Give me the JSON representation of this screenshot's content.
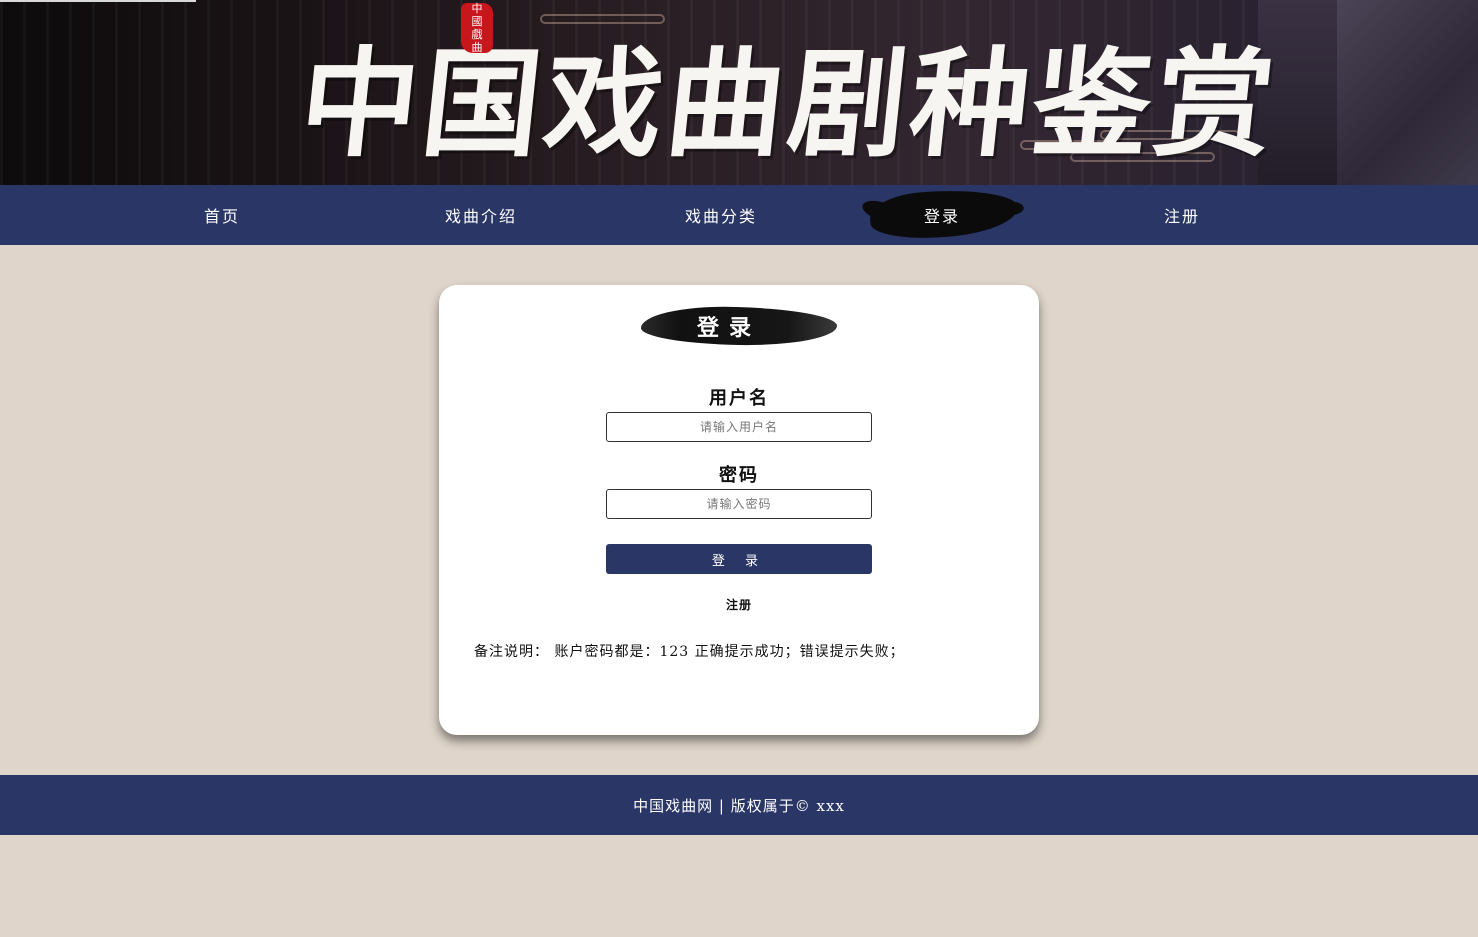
{
  "banner": {
    "title": "中国戏曲剧种鉴赏",
    "seal_chars": [
      "中",
      "國",
      "戲",
      "曲"
    ]
  },
  "nav": {
    "items": [
      {
        "label": "首页",
        "active": false
      },
      {
        "label": "戏曲介绍",
        "active": false
      },
      {
        "label": "戏曲分类",
        "active": false
      },
      {
        "label": "登录",
        "active": true
      },
      {
        "label": "注册",
        "active": false
      }
    ]
  },
  "login": {
    "title": "登录",
    "username_label": "用户名",
    "username_placeholder": "请输入用户名",
    "username_value": "",
    "password_label": "密码",
    "password_placeholder": "请输入密码",
    "password_value": "",
    "submit_label": "登 录",
    "register_link": "注册",
    "note": "备注说明： 账户密码都是：123 正确提示成功；错误提示失败；"
  },
  "footer": {
    "text": "中国戏曲网 | 版权属于© xxx"
  },
  "colors": {
    "nav_bg": "#2a3666",
    "page_bg": "#dfd5ca",
    "card_bg": "#ffffff",
    "seal_red": "#c8161d"
  }
}
